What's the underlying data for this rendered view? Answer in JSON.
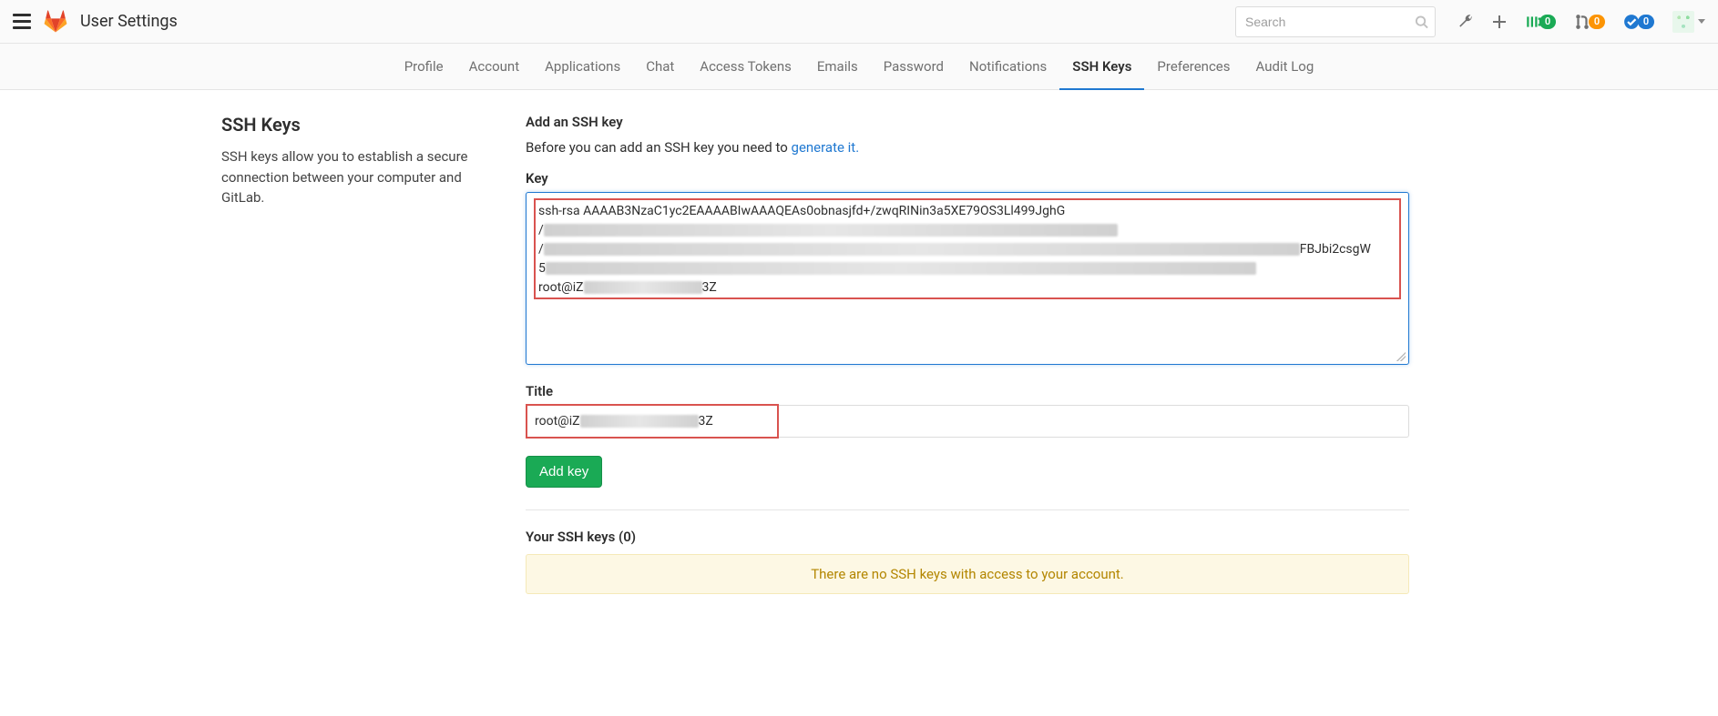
{
  "header": {
    "page_title": "User Settings",
    "search_placeholder": "Search",
    "issues_count": "0",
    "mr_count": "0",
    "todo_count": "0"
  },
  "tabs": [
    {
      "label": "Profile",
      "active": false
    },
    {
      "label": "Account",
      "active": false
    },
    {
      "label": "Applications",
      "active": false
    },
    {
      "label": "Chat",
      "active": false
    },
    {
      "label": "Access Tokens",
      "active": false
    },
    {
      "label": "Emails",
      "active": false
    },
    {
      "label": "Password",
      "active": false
    },
    {
      "label": "Notifications",
      "active": false
    },
    {
      "label": "SSH Keys",
      "active": true
    },
    {
      "label": "Preferences",
      "active": false
    },
    {
      "label": "Audit Log",
      "active": false
    }
  ],
  "sidebar": {
    "title": "SSH Keys",
    "description": "SSH keys allow you to establish a secure connection between your computer and GitLab."
  },
  "form": {
    "section_heading": "Add an SSH key",
    "help_prefix": "Before you can add an SSH key you need to ",
    "help_link": "generate it.",
    "key_label": "Key",
    "key_line1": "ssh-rsa AAAAB3NzaC1yc2EAAAABIwAAAQEAs0obnasjfd+/zwqRINin3a5XE79OS3Ll499JghG",
    "key_line3_prefix": "/",
    "key_line3_suffix": "FBJbi2csgW",
    "key_line4_prefix": "5",
    "key_line5_prefix": "root@iZ",
    "key_line5_suffix": "3Z",
    "title_label": "Title",
    "title_prefix": "root@iZ",
    "title_suffix": "3Z",
    "add_button": "Add key"
  },
  "keys_list": {
    "heading": "Your SSH keys (0)",
    "empty_msg": "There are no SSH keys with access to your account."
  }
}
